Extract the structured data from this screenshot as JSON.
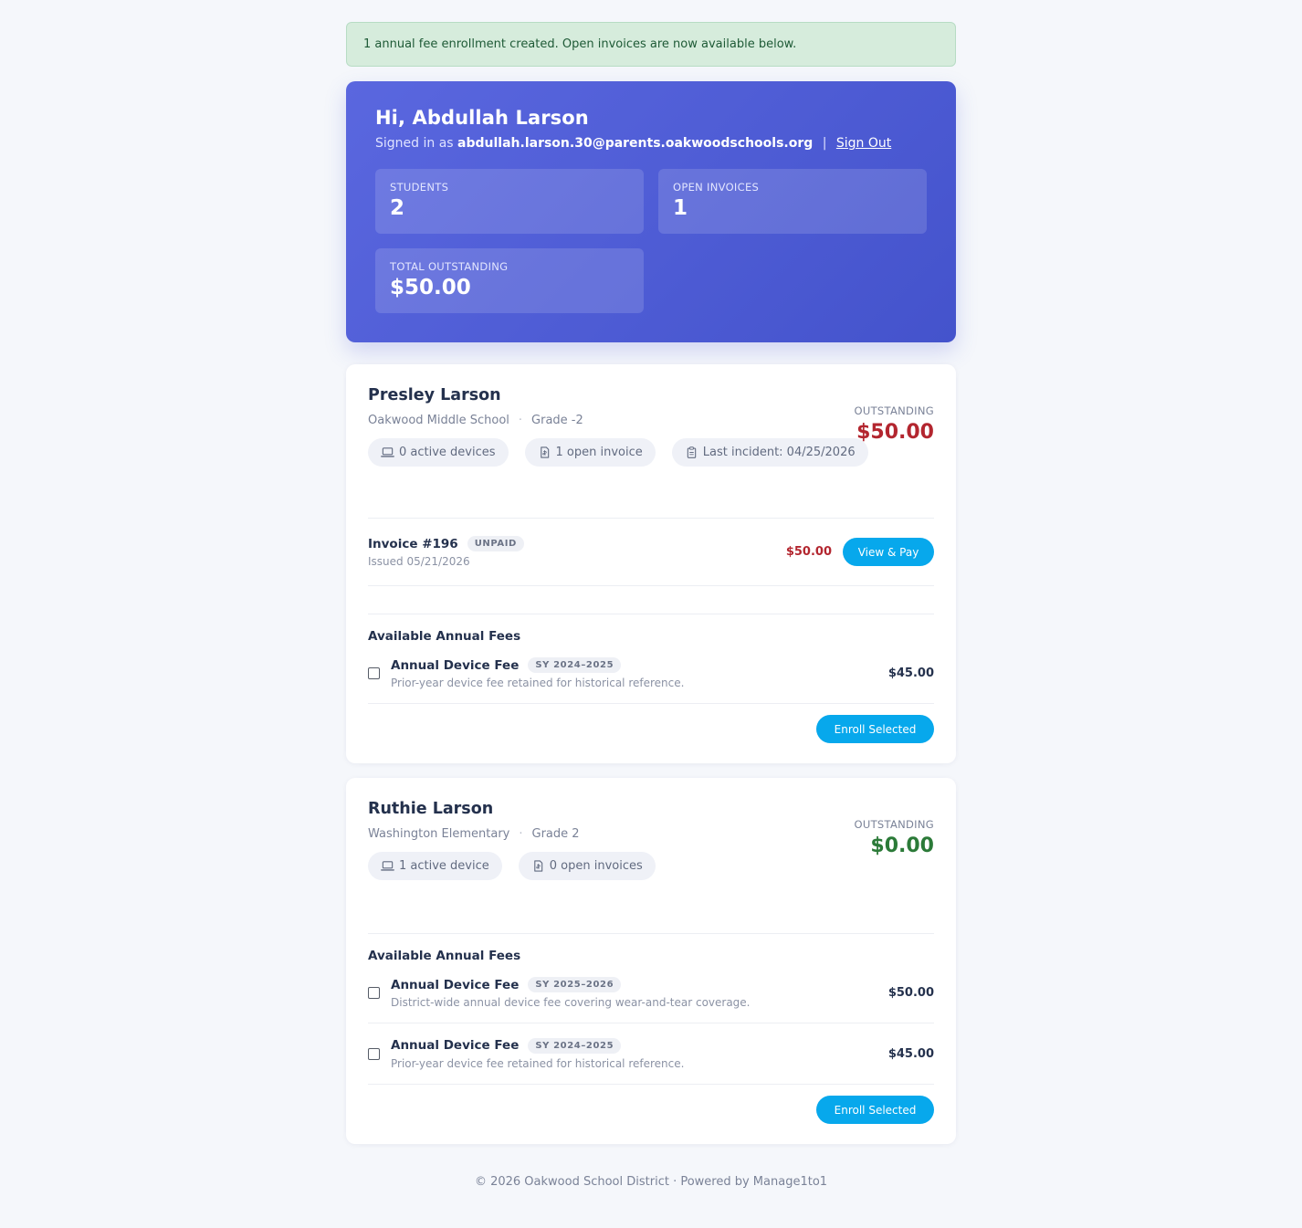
{
  "alert": {
    "message": "1 annual fee enrollment created. Open invoices are now available below."
  },
  "hero": {
    "greeting": "Hi, Abdullah Larson",
    "signed_in_prefix": "Signed in as",
    "email": "abdullah.larson.30@parents.oakwoodschools.org",
    "separator": "|",
    "sign_out": "Sign Out",
    "stats": [
      {
        "label": "Students",
        "value": "2"
      },
      {
        "label": "Open Invoices",
        "value": "1"
      },
      {
        "label": "Total Outstanding",
        "value": "$50.00"
      }
    ]
  },
  "students": [
    {
      "name": "Presley Larson",
      "school": "Oakwood Middle School",
      "dot": "·",
      "grade": "Grade -2",
      "chips": [
        {
          "icon": "laptop-icon",
          "label": "0 active devices"
        },
        {
          "icon": "invoice-icon",
          "label": "1 open invoice"
        },
        {
          "icon": "clipboard-icon",
          "label": "Last incident: 04/25/2026"
        }
      ],
      "outstanding_label": "Outstanding",
      "outstanding_value": "$50.00",
      "outstanding_color": "#b3262f",
      "invoices": [
        {
          "title": "Invoice #196",
          "status": "UNPAID",
          "issued": "Issued 05/21/2026",
          "amount": "$50.00",
          "action": "View & Pay"
        }
      ],
      "fees_title": "Available Annual Fees",
      "fees": [
        {
          "title": "Annual Device Fee",
          "year": "SY 2024–2025",
          "desc": "Prior-year device fee retained for historical reference.",
          "amount": "$45.00"
        }
      ],
      "enroll_label": "Enroll Selected"
    },
    {
      "name": "Ruthie Larson",
      "school": "Washington Elementary",
      "dot": "·",
      "grade": "Grade 2",
      "chips": [
        {
          "icon": "laptop-icon",
          "label": "1 active device"
        },
        {
          "icon": "invoice-icon",
          "label": "0 open invoices"
        }
      ],
      "outstanding_label": "Outstanding",
      "outstanding_value": "$0.00",
      "outstanding_color": "#2b7a38",
      "fees_title": "Available Annual Fees",
      "fees": [
        {
          "title": "Annual Device Fee",
          "year": "SY 2025–2026",
          "desc": "District-wide annual device fee covering wear-and-tear coverage.",
          "amount": "$50.00"
        },
        {
          "title": "Annual Device Fee",
          "year": "SY 2024–2025",
          "desc": "Prior-year device fee retained for historical reference.",
          "amount": "$45.00"
        }
      ],
      "enroll_label": "Enroll Selected"
    }
  ],
  "footer": {
    "text": "© 2026 Oakwood School District · Powered by Manage1to1"
  },
  "colors": {
    "accent": "#07a8ec",
    "hero": "#4f5dd6",
    "danger": "#b3262f",
    "success": "#2b7a38"
  }
}
